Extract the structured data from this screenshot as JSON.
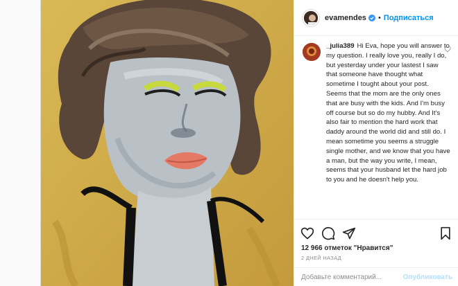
{
  "post": {
    "username": "evamendes",
    "dot": "•",
    "follow_label": "Подписаться"
  },
  "comment": {
    "username": "_julia389",
    "text": "Hi Eva, hope you will answer to my question. I really love you, really I do, but yesterday under your lastest I saw that someone have thought what sometime I tought about your post. Seems that the mom are the only ones that are busy with the kids. And I'm busy off course but so do my hubby. And It's also fair to mention the hard work that daddy around the world did and still do. I mean sometime you seems a struggle single mother, and we know that you have a man, but the way you write, I mean, seems that your husband let the hard job to you and he doesn't help you."
  },
  "likes_label": "12 966 отметок \"Нравится\"",
  "time_label": "2 ДНЕЙ НАЗАД",
  "add_comment": {
    "placeholder": "Добавьте комментарий...",
    "publish_label": "Опубликовать"
  },
  "colors": {
    "accent": "#0095f6",
    "publish_disabled": "#b2dffc",
    "painting_bg": "#c9a646"
  },
  "icons": [
    "verified-icon",
    "heart-icon",
    "comment-icon",
    "share-icon",
    "bookmark-icon"
  ]
}
